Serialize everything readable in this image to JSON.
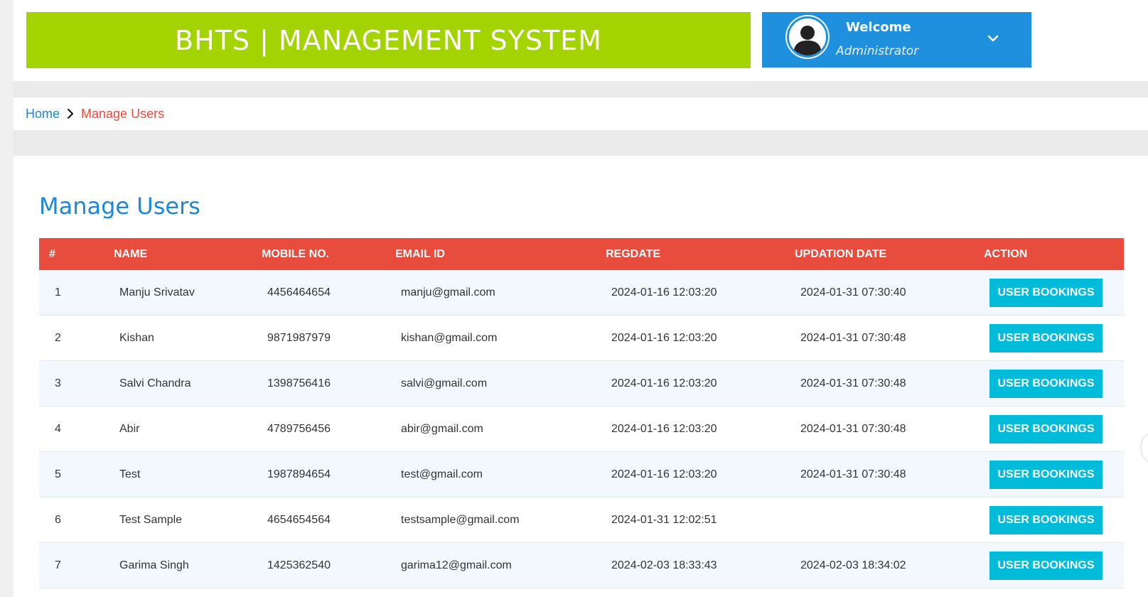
{
  "header": {
    "brand_title": "BHTS | MANAGEMENT SYSTEM",
    "welcome_label": "Welcome",
    "role_label": "Administrator",
    "brand_color": "#a3d400",
    "welcome_color": "#1e90dd"
  },
  "breadcrumb": {
    "home": "Home",
    "current": "Manage Users"
  },
  "main": {
    "title": "Manage Users",
    "table": {
      "headers": [
        "#",
        "NAME",
        "MOBILE NO.",
        "EMAIL ID",
        "REGDATE",
        "UPDATION DATE",
        "ACTION"
      ],
      "header_color": "#e74c3c",
      "action_label": "USER BOOKINGS",
      "action_color": "#00bcd9",
      "rows": [
        {
          "num": "1",
          "name": "Manju Srivatav",
          "mobile": "4456464654",
          "email": "manju@gmail.com",
          "regdate": "2024-01-16 12:03:20",
          "updated": "2024-01-31 07:30:40",
          "action": "USER BOOKINGS"
        },
        {
          "num": "2",
          "name": "Kishan",
          "mobile": "9871987979",
          "email": "kishan@gmail.com",
          "regdate": "2024-01-16 12:03:20",
          "updated": "2024-01-31 07:30:48",
          "action": "USER BOOKINGS"
        },
        {
          "num": "3",
          "name": "Salvi Chandra",
          "mobile": "1398756416",
          "email": "salvi@gmail.com",
          "regdate": "2024-01-16 12:03:20",
          "updated": "2024-01-31 07:30:48",
          "action": "USER BOOKINGS"
        },
        {
          "num": "4",
          "name": "Abir",
          "mobile": "4789756456",
          "email": "abir@gmail.com",
          "regdate": "2024-01-16 12:03:20",
          "updated": "2024-01-31 07:30:48",
          "action": "USER BOOKINGS"
        },
        {
          "num": "5",
          "name": "Test",
          "mobile": "1987894654",
          "email": "test@gmail.com",
          "regdate": "2024-01-16 12:03:20",
          "updated": "2024-01-31 07:30:48",
          "action": "USER BOOKINGS"
        },
        {
          "num": "6",
          "name": "Test Sample",
          "mobile": "4654654564",
          "email": "testsample@gmail.com",
          "regdate": "2024-01-31 12:02:51",
          "updated": "",
          "action": "USER BOOKINGS"
        },
        {
          "num": "7",
          "name": "Garima Singh",
          "mobile": "1425362540",
          "email": "garima12@gmail.com",
          "regdate": "2024-02-03 18:33:43",
          "updated": "2024-02-03 18:34:02",
          "action": "USER BOOKINGS"
        }
      ]
    }
  },
  "icons": {
    "avatar": "user-avatar-icon",
    "dropdown": "chevron-down-icon",
    "breadcrumb_separator": "chevron-right-icon"
  }
}
